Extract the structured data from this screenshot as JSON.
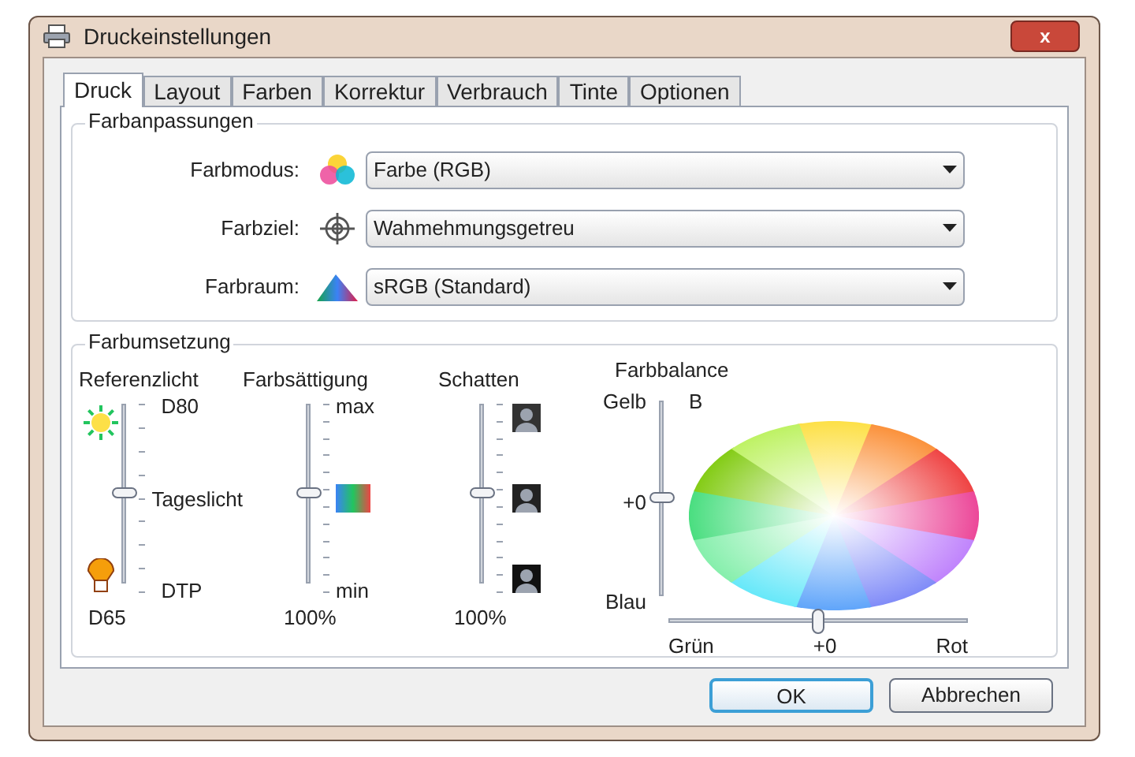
{
  "window": {
    "title": "Druckeinstellungen",
    "close": "x"
  },
  "tabs": [
    {
      "label": "Druck",
      "selected": true
    },
    {
      "label": "Layout",
      "selected": false
    },
    {
      "label": "Farben",
      "selected": false
    },
    {
      "label": "Korrektur",
      "selected": false
    },
    {
      "label": "Verbrauch",
      "selected": false
    },
    {
      "label": "Tinte",
      "selected": false
    },
    {
      "label": "Optionen",
      "selected": false
    }
  ],
  "farbanpassungen": {
    "title": "Farbanpassungen",
    "rows": [
      {
        "kind": "mode",
        "label": "Farbmodus:",
        "value": "Farbe (RGB)"
      },
      {
        "kind": "target",
        "label": "Farbziel:",
        "value": "Wahmehmungsgetreu"
      },
      {
        "kind": "space",
        "label": "Farbraum:",
        "value": "sRGB (Standard)"
      }
    ]
  },
  "farbumsetzung": {
    "title": "Farbumsetzung",
    "referenzlicht": {
      "title": "Referenzlicht",
      "top": "D80",
      "middle": "Tageslicht",
      "bottom": "DTP",
      "value": "D65",
      "level": 0.5
    },
    "saettigung": {
      "title": "Farbsättigung",
      "top": "max",
      "bottom": "min",
      "value": "100%",
      "level": 0.5
    },
    "schatten": {
      "title": "Schatten",
      "value": "100%",
      "level": 0.5
    },
    "balance": {
      "title": "Farbbalance",
      "top": "Gelb",
      "top_right": "B",
      "vertical_value": "+0",
      "bottom": "Blau",
      "left": "Grün",
      "horizontal_value": "+0",
      "right": "Rot",
      "vertical": {
        "level": 0.5
      },
      "horizontal": {
        "level": 0.5
      }
    }
  },
  "buttons": [
    {
      "label": "OK",
      "default": true
    },
    {
      "label": "Abbrechen",
      "default": false
    }
  ]
}
